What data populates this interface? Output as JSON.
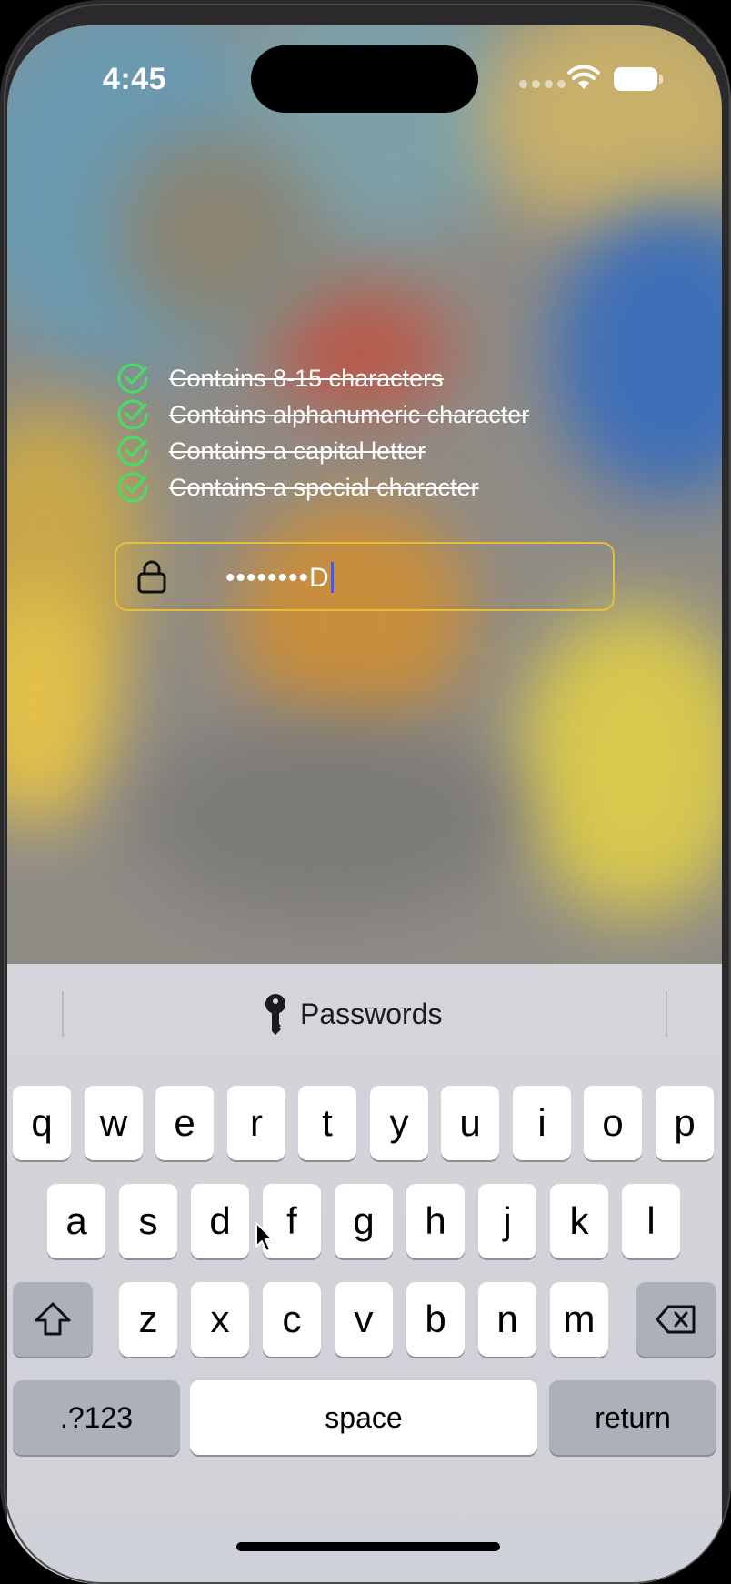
{
  "status_bar": {
    "time": "4:45"
  },
  "requirements": [
    {
      "label": "Contains 8-15 characters",
      "met": true
    },
    {
      "label": "Contains alphanumeric character",
      "met": true
    },
    {
      "label": "Contains a capital letter",
      "met": true
    },
    {
      "label": "Contains a special character",
      "met": true
    }
  ],
  "password_field": {
    "value": "••••••••D"
  },
  "keyboard": {
    "suggestion": "Passwords",
    "row1": [
      "q",
      "w",
      "e",
      "r",
      "t",
      "y",
      "u",
      "i",
      "o",
      "p"
    ],
    "row2": [
      "a",
      "s",
      "d",
      "f",
      "g",
      "h",
      "j",
      "k",
      "l"
    ],
    "row3": [
      "z",
      "x",
      "c",
      "v",
      "b",
      "n",
      "m"
    ],
    "numbers_key": ".?123",
    "space_key": "space",
    "return_key": "return"
  },
  "colors": {
    "check": "#4cd964",
    "field_border": "#e6bf3a",
    "caret": "#3b5bff"
  }
}
